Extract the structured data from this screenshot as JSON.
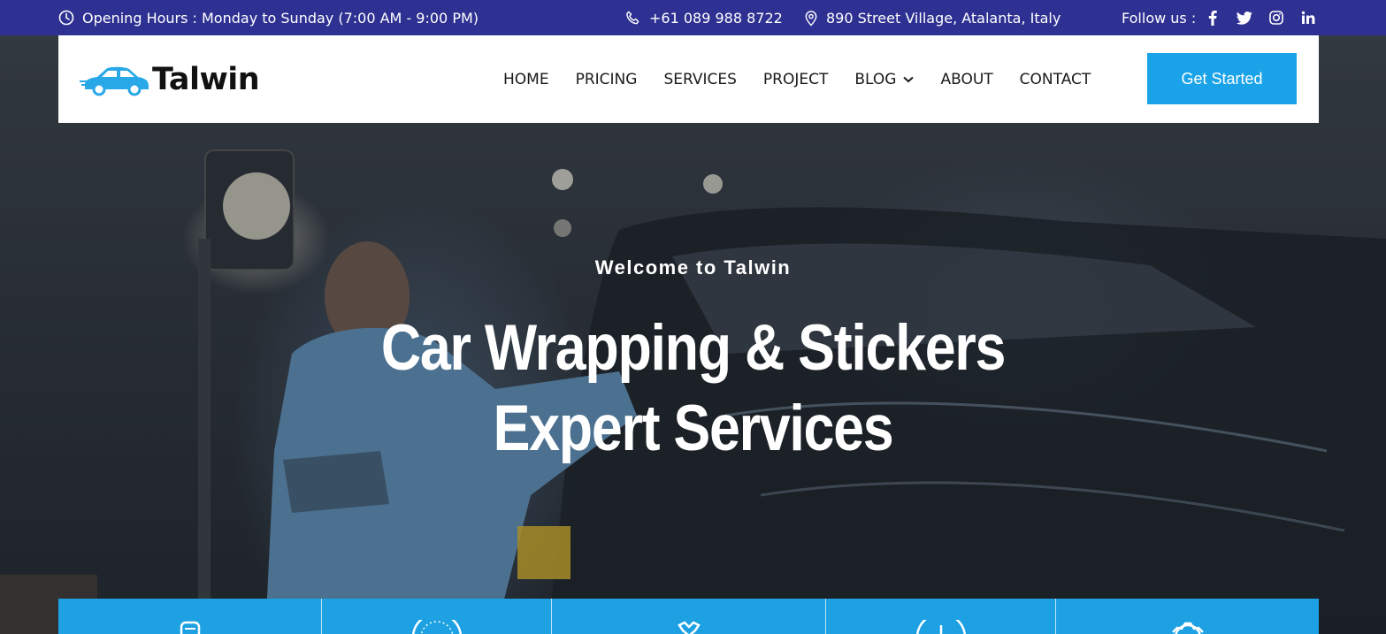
{
  "topbar": {
    "hours": "Opening Hours : Monday to Sunday (7:00 AM - 9:00 PM)",
    "phone": "+61 089 988 8722",
    "address": "890 Street Village, Atalanta, Italy",
    "follow_label": "Follow us :",
    "social_icons": [
      "facebook-icon",
      "twitter-icon",
      "instagram-icon",
      "linkedin-icon"
    ]
  },
  "header": {
    "logo_text": "Talwin",
    "nav": [
      "HOME",
      "PRICING",
      "SERVICES",
      "PROJECT",
      "BLOG",
      "ABOUT",
      "CONTACT"
    ],
    "cta_label": "Get Started"
  },
  "hero": {
    "eyebrow": "Welcome to Talwin",
    "title_line1": "Car Wrapping & Stickers",
    "title_line2": "Expert Services"
  },
  "features": {
    "icons": [
      "seat-icon",
      "gauge-icon",
      "technician-icon",
      "speedometer-icon",
      "gear-icon"
    ]
  },
  "colors": {
    "topbar_bg": "#2e3192",
    "accent": "#1aa3e8",
    "feature_strip": "#1da1e2"
  }
}
